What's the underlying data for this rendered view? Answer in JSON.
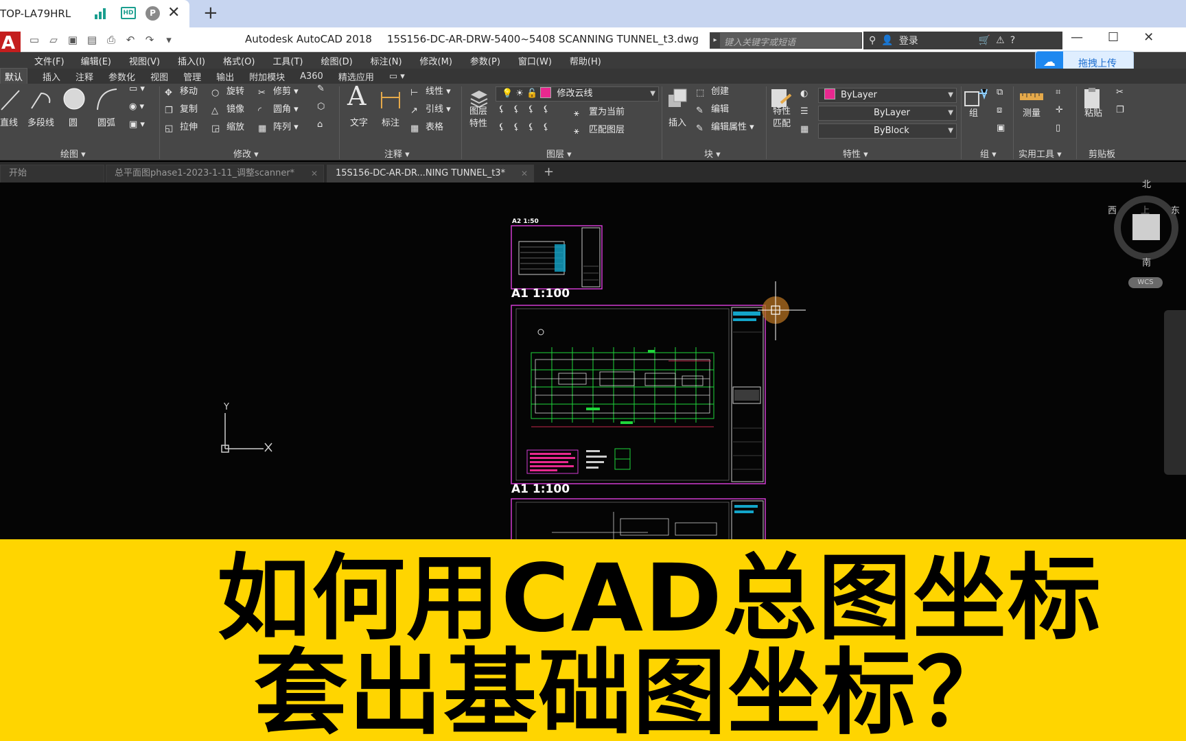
{
  "outer_tab": {
    "title": "TOP-LA79HRL",
    "hd_badge": "HD",
    "p_badge": "P"
  },
  "app": {
    "title_app": "Autodesk AutoCAD 2018",
    "title_file": "15S156-DC-AR-DRW-5400~5408 SCANNING TUNNEL_t3.dwg",
    "search_placeholder": "键入关键字或短语",
    "login_label": "登录"
  },
  "upload": {
    "label": "拖拽上传"
  },
  "menu": [
    "文件(F)",
    "编辑(E)",
    "视图(V)",
    "插入(I)",
    "格式(O)",
    "工具(T)",
    "绘图(D)",
    "标注(N)",
    "修改(M)",
    "参数(P)",
    "窗口(W)",
    "帮助(H)"
  ],
  "ribbon_tabs": [
    "默认",
    "插入",
    "注释",
    "参数化",
    "视图",
    "管理",
    "输出",
    "附加模块",
    "A360",
    "精选应用"
  ],
  "ribbon": {
    "draw": {
      "line": "直线",
      "polyline": "多段线",
      "circle": "圆",
      "arc": "圆弧",
      "footer": "绘图 ▾"
    },
    "modify": {
      "move": "移动",
      "rotate": "旋转",
      "trim": "修剪",
      "copy": "复制",
      "mirror": "镜像",
      "fillet": "圆角",
      "stretch": "拉伸",
      "scale": "缩放",
      "array": "阵列",
      "footer": "修改 ▾"
    },
    "annotation": {
      "text": "文字",
      "dimension": "标注",
      "linear": "线性",
      "leader": "引线",
      "table": "表格",
      "footer": "注释 ▾"
    },
    "layers": {
      "layer_props_1": "图层",
      "layer_props_2": "特性",
      "current_layer": "修改云线",
      "make_current": "置为当前",
      "match_layer": "匹配图层",
      "footer": "图层 ▾"
    },
    "block": {
      "insert": "插入",
      "create": "创建",
      "edit": "编辑",
      "edit_attr": "编辑属性",
      "footer": "块 ▾"
    },
    "properties": {
      "match_1": "特性",
      "match_2": "匹配",
      "color": "ByLayer",
      "linetype": "ByLayer",
      "lineweight": "ByBlock",
      "footer": "特性 ▾"
    },
    "groups": {
      "group": "组",
      "footer": "组 ▾"
    },
    "utilities": {
      "measure": "测量",
      "footer": "实用工具 ▾"
    },
    "clipboard": {
      "paste": "粘贴",
      "footer": "剪贴板"
    }
  },
  "file_tabs": [
    {
      "label": "开始"
    },
    {
      "label": "总平面图phase1-2023-1-11_调整scanner*"
    },
    {
      "label": "15S156-DC-AR-DR...NING TUNNEL_t3*"
    }
  ],
  "canvas": {
    "sheet_small_label": "A2 1:50",
    "sheet1_label": "A1 1:100",
    "sheet2_label": "A1 1:100",
    "ucs_y": "Y",
    "ucs_x": "X"
  },
  "viewcube": {
    "north": "北",
    "south": "南",
    "east": "东",
    "west": "西",
    "top": "上",
    "wcs": "WCS"
  },
  "caption": {
    "line1": "如何用CAD总图坐标",
    "line2": "套出基础图坐标？"
  }
}
